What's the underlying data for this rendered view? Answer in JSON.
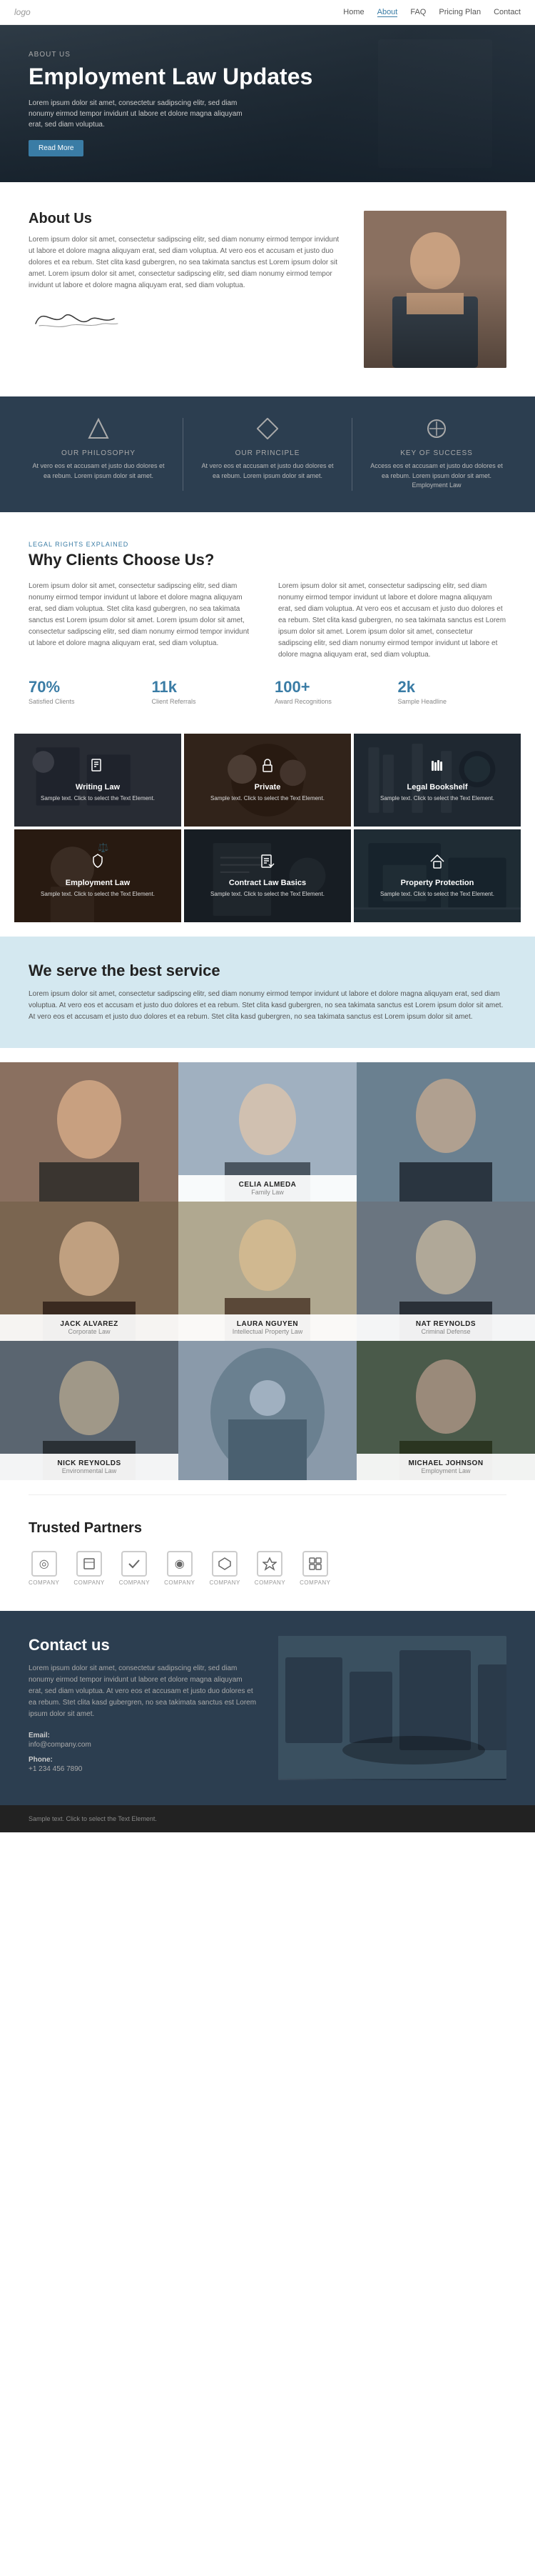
{
  "nav": {
    "logo": "logo",
    "links": [
      {
        "label": "Home",
        "active": false
      },
      {
        "label": "About",
        "active": true
      },
      {
        "label": "FAQ",
        "active": false
      },
      {
        "label": "Pricing Plan",
        "active": false
      },
      {
        "label": "Contact",
        "active": false
      }
    ]
  },
  "hero": {
    "tag": "ABOUT US",
    "title": "Employment Law Updates",
    "desc": "Lorem ipsum dolor sit amet, consectetur sadipscing elitr, sed diam nonumy eirmod tempor invidunt ut labore et dolore magna aliquyam erat, sed diam voluptua.",
    "btn": "Read More"
  },
  "about": {
    "heading": "About Us",
    "para1": "Lorem ipsum dolor sit amet, consectetur sadipscing elitr, sed diam nonumy eirmod tempor invidunt ut labore et dolore magna aliquyam erat, sed diam voluptua. At vero eos et accusam et justo duo dolores et ea rebum. Stet clita kasd gubergren, no sea takimata sanctus est Lorem ipsum dolor sit amet. Lorem ipsum dolor sit amet, consectetur sadipscing elitr, sed diam nonumy eirmod tempor invidunt ut labore et dolore magna aliquyam erat, sed diam voluptua.",
    "signature": "A. deForest"
  },
  "philosophy": {
    "items": [
      {
        "icon": "⚡",
        "title": "OUR PHILOSOPHY",
        "text": "At vero eos et accusam et justo duo dolores et ea rebum. Lorem ipsum dolor sit amet."
      },
      {
        "icon": "🔷",
        "title": "OUR PRINCIPLE",
        "text": "At vero eos et accusam et justo duo dolores et ea rebum. Lorem ipsum dolor sit amet."
      },
      {
        "icon": "🔑",
        "title": "KEY OF SUCCESS",
        "text": "Access eos et accusam et justo duo dolores et ea rebum. Lorem ipsum dolor sit amet. Employment Law"
      }
    ]
  },
  "why": {
    "tag": "LEGAL RIGHTS EXPLAINED",
    "heading": "Why Clients Choose Us?",
    "col1": "Lorem ipsum dolor sit amet, consectetur sadipscing elitr, sed diam nonumy eirmod tempor invidunt ut labore et dolore magna aliquyam erat, sed diam voluptua. Stet clita kasd gubergren, no sea takimata sanctus est Lorem ipsum dolor sit amet. Lorem ipsum dolor sit amet, consectetur sadipscing elitr, sed diam nonumy eirmod tempor invidunt ut labore et dolore magna aliquyam erat, sed diam voluptua.",
    "col2": "Lorem ipsum dolor sit amet, consectetur sadipscing elitr, sed diam nonumy eirmod tempor invidunt ut labore et dolore magna aliquyam erat, sed diam voluptua. At vero eos et accusam et justo duo dolores et ea rebum. Stet clita kasd gubergren, no sea takimata sanctus est Lorem ipsum dolor sit amet. Lorem ipsum dolor sit amet, consectetur sadipscing elitr, sed diam nonumy eirmod tempor invidunt ut labore et dolore magna aliquyam erat, sed diam voluptua.",
    "stats": [
      {
        "number": "70%",
        "label": "Satisfied Clients"
      },
      {
        "number": "11k",
        "label": "Client Referrals"
      },
      {
        "number": "100+",
        "label": "Award Recognitions"
      },
      {
        "number": "2k",
        "label": "Sample Headline"
      }
    ]
  },
  "services": [
    {
      "icon": "📋",
      "title": "Writing Law",
      "desc": "Sample text. Click to select the Text Element."
    },
    {
      "icon": "⚖️",
      "title": "Private",
      "desc": "Sample text. Click to select the Text Element."
    },
    {
      "icon": "📚",
      "title": "Legal Bookshelf",
      "desc": "Sample text. Click to select the Text Element."
    },
    {
      "icon": "💼",
      "title": "Employment Law",
      "desc": "Sample text. Click to select the Text Element."
    },
    {
      "icon": "📄",
      "title": "Contract Law Basics",
      "desc": "Sample text. Click to select the Text Element."
    },
    {
      "icon": "🏠",
      "title": "Property Protection",
      "desc": "Sample text. Click to select the Text Element."
    }
  ],
  "best_service": {
    "heading": "We serve the best service",
    "text": "Lorem ipsum dolor sit amet, consectetur sadipscing elitr, sed diam nonumy eirmod tempor invidunt ut labore et dolore magna aliquyam erat, sed diam voluptua. At vero eos et accusam et justo duo dolores et ea rebum. Stet clita kasd gubergren, no sea takimata sanctus est Lorem ipsum dolor sit amet. At vero eos et accusam et justo duo dolores et ea rebum. Stet clita kasd gubergren, no sea takimata sanctus est Lorem ipsum dolor sit amet."
  },
  "team": [
    {
      "name": "CELIA ALMEDA",
      "role": "Family Law",
      "position": "top-center"
    },
    {
      "name": "JACK ALVAREZ",
      "role": "Corporate Law",
      "position": "mid-left"
    },
    {
      "name": "NAT REYNOLDS",
      "role": "Criminal Defense",
      "position": "mid-right"
    },
    {
      "name": "LAURA NGUYEN",
      "role": "Intellectual Property Law",
      "position": "mid-center"
    },
    {
      "name": "NICK REYNOLDS",
      "role": "Environmental Law",
      "position": "bot-left"
    },
    {
      "name": "MICHAEL JOHNSON",
      "role": "Employment Law",
      "position": "bot-right"
    }
  ],
  "partners": {
    "heading": "Trusted Partners",
    "logos": [
      {
        "icon": "◎",
        "label": "COMPANY"
      },
      {
        "icon": "📖",
        "label": "COMPANY"
      },
      {
        "icon": "✔",
        "label": "COMPANY"
      },
      {
        "icon": "◉",
        "label": "COMPANY"
      },
      {
        "icon": "⬡",
        "label": "COMPANY"
      },
      {
        "icon": "⚡",
        "label": "COMPANY"
      },
      {
        "icon": "⊞",
        "label": "COMPANY"
      }
    ]
  },
  "contact": {
    "heading": "Contact us",
    "desc": "Lorem ipsum dolor sit amet, consectetur sadipscing elitr, sed diam nonumy eirmod tempor invidunt ut labore et dolore magna aliquyam erat, sed diam voluptua. At vero eos et accusam et justo duo dolores et ea rebum. Stet clita kasd gubergren, no sea takimata sanctus est Lorem ipsum dolor sit amet.",
    "email_label": "Email:",
    "email_value": "info@company.com",
    "phone_label": "Phone:",
    "phone_value": "+1 234 456 7890"
  },
  "footer": {
    "sample": "Sample text. Click to select the Text Element."
  }
}
